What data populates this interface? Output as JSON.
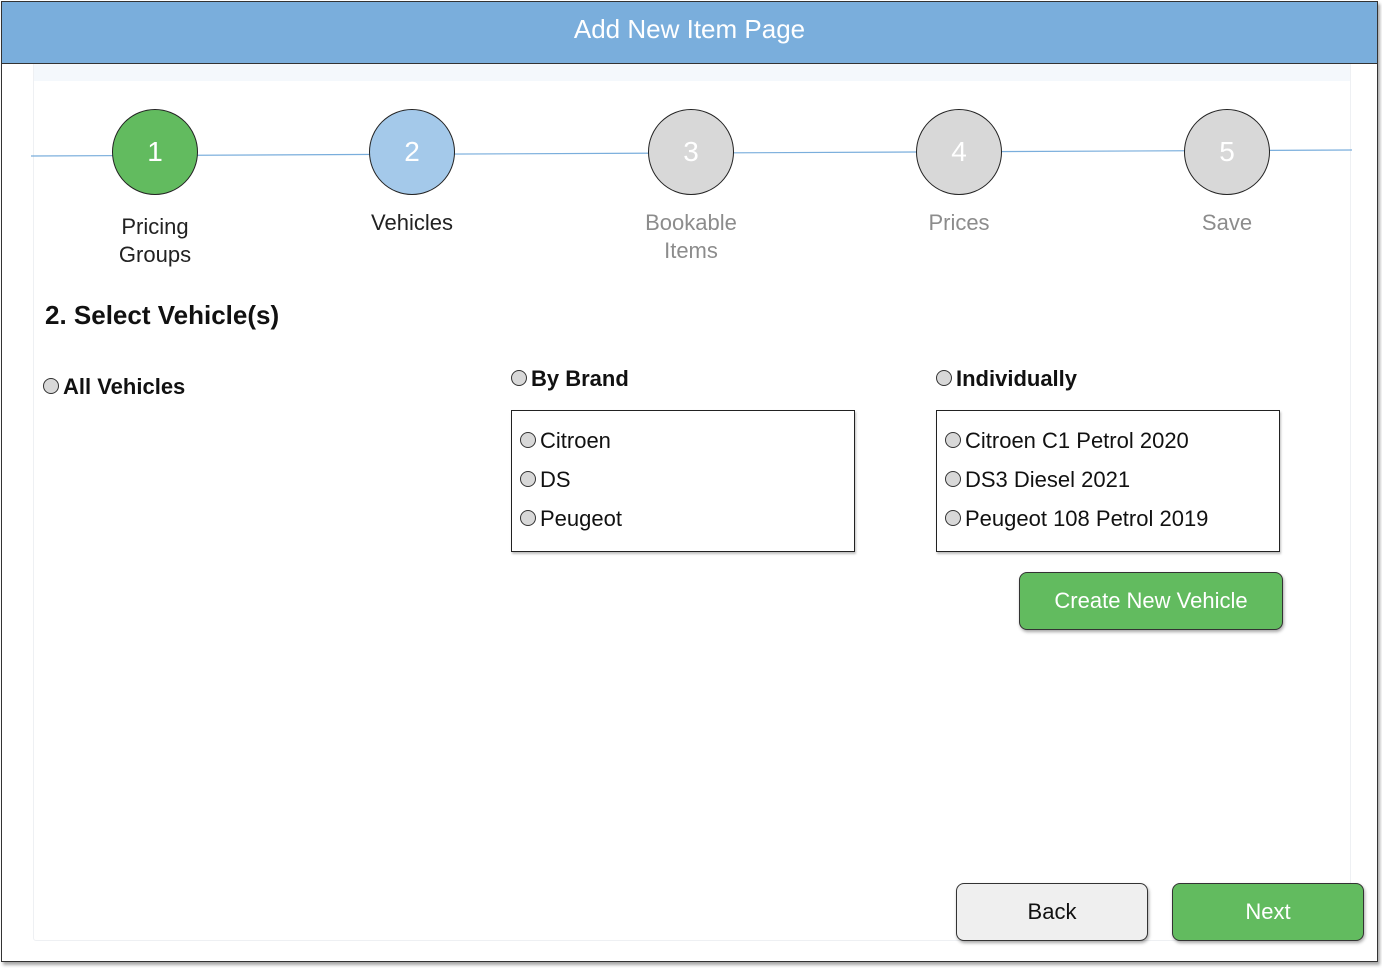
{
  "header": {
    "title": "Add New Item Page"
  },
  "steps": [
    {
      "number": "1",
      "label": "Pricing Groups",
      "state": "done"
    },
    {
      "number": "2",
      "label": "Vehicles",
      "state": "current"
    },
    {
      "number": "3",
      "label": "Bookable Items",
      "state": "future"
    },
    {
      "number": "4",
      "label": "Prices",
      "state": "future"
    },
    {
      "number": "5",
      "label": "Save",
      "state": "future"
    }
  ],
  "section": {
    "title": "2. Select Vehicle(s)"
  },
  "options": {
    "all": {
      "label": "All Vehicles"
    },
    "brand": {
      "label": "By Brand",
      "items": [
        "Citroen",
        "DS",
        "Peugeot"
      ]
    },
    "individual": {
      "label": "Individually",
      "items": [
        "Citroen C1 Petrol 2020",
        "DS3 Diesel 2021",
        "Peugeot 108 Petrol 2019"
      ]
    }
  },
  "buttons": {
    "create_vehicle": "Create New Vehicle",
    "back": "Back",
    "next": "Next"
  },
  "colors": {
    "header": "#7aaedc",
    "done": "#62bb5f",
    "current": "#a4c9ea",
    "future": "#d8d8d8",
    "primary_button": "#62bb5f"
  }
}
